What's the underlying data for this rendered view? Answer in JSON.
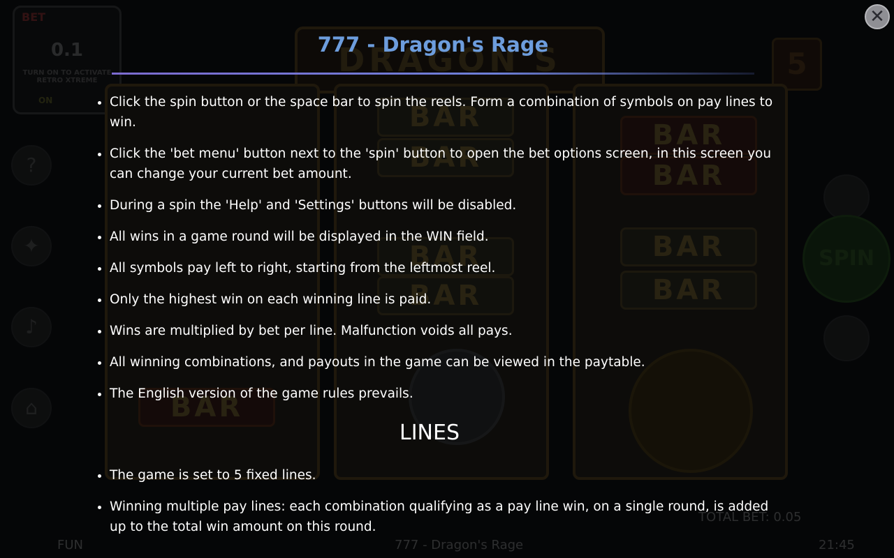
{
  "game": {
    "title": "777 - Dragon's Rage",
    "bet_label": "BET",
    "bet_value": "0.1",
    "retro_note": "TURN ON TO ACTIVATE RETRO XTREME",
    "retro_toggle": "ON",
    "lines_count": "5",
    "spin_label": "SPIN",
    "reel_symbol": "BAR",
    "mode_label": "FUN",
    "total_bet": "TOTAL BET: 0.05",
    "clock": "21:45"
  },
  "help": {
    "title": "777 - Dragon's Rage",
    "close_label": "✕",
    "rules": [
      "Click the spin button or the space bar to spin the reels. Form a combination of symbols on pay lines to win.",
      "Click the 'bet menu' button next to the 'spin' button to open the bet options screen, in this screen you can change your current bet amount.",
      "During a spin the 'Help' and 'Settings' buttons will be disabled.",
      "All wins in a game round will be displayed in the WIN field.",
      "All symbols pay left to right, starting from the leftmost reel.",
      "Only the highest win on each winning line is paid.",
      "Wins are multiplied by bet per line. Malfunction voids all pays.",
      "All winning combinations, and payouts in the game can be viewed in the paytable.",
      "The English version of the game rules prevails."
    ],
    "lines_heading": "LINES",
    "lines_rules": [
      "The game is set to 5 fixed lines.",
      "Winning multiple pay lines: each combination qualifying as a pay line win, on a single round, is added up to the total win amount on this round."
    ]
  }
}
